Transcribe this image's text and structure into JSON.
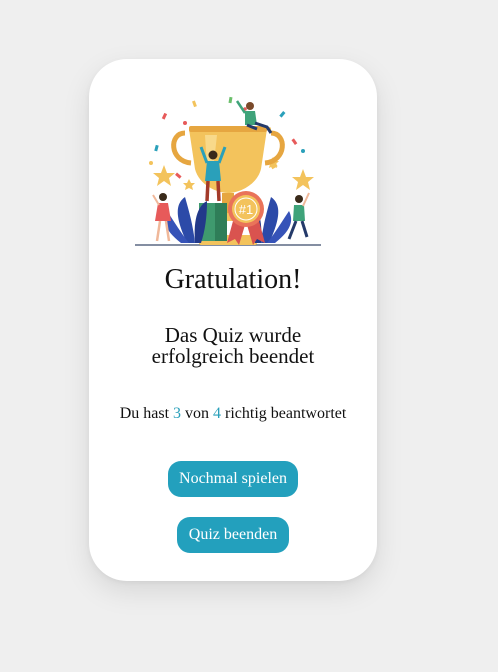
{
  "card": {
    "illustration_badge": "#1",
    "title": "Gratulation!",
    "subtitle": "Das Quiz wurde erfolgreich beendet",
    "score": {
      "prefix": "Du hast",
      "correct": "3",
      "middle": "von",
      "total": "4",
      "suffix": "richtig beantwortet"
    },
    "buttons": {
      "replay_label": "Nochmal spielen",
      "quit_label": "Quiz beenden"
    }
  },
  "colors": {
    "accent": "#23a0bd",
    "background": "#efefef",
    "card": "#ffffff",
    "trophy_gold": "#f3c35c",
    "plant_blue": "#2c4aa8"
  }
}
